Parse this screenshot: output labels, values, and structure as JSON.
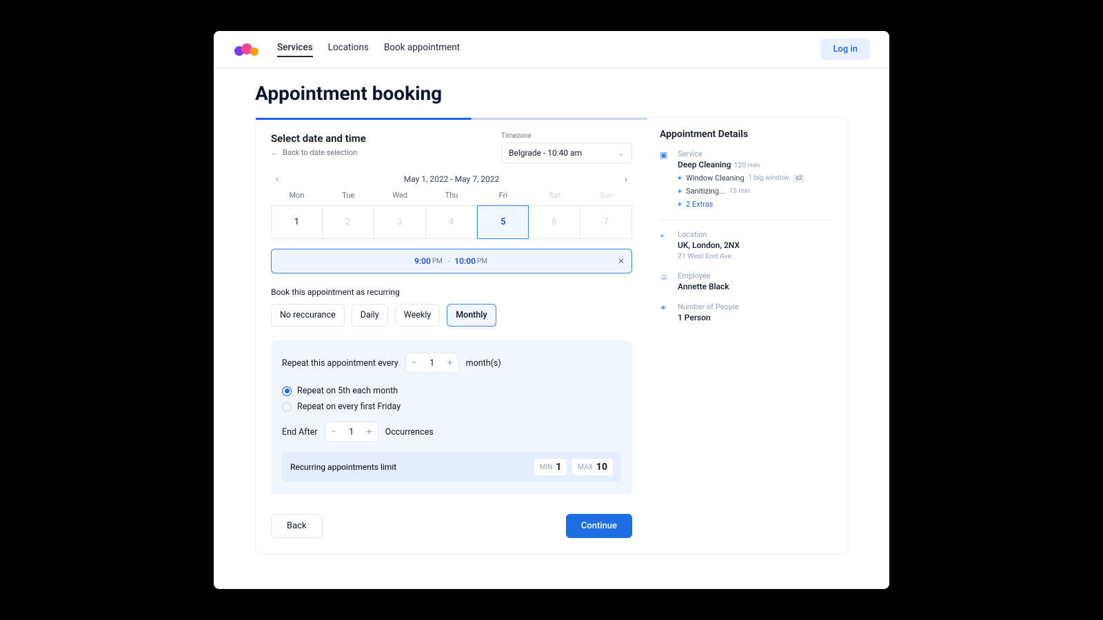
{
  "nav": {
    "services": "Services",
    "locations": "Locations",
    "book": "Book appointment",
    "login": "Log in"
  },
  "page": {
    "title": "Appointment booking"
  },
  "step": {
    "title": "Select date and time",
    "back": "Back to date selection",
    "tzLabel": "Timezone",
    "tzValue": "Belgrade - 10:40 am",
    "range": "May 1, 2022 - May 7, 2022",
    "dayHeads": [
      "Mon",
      "Tue",
      "Wed",
      "Thu",
      "Fri",
      "Sat",
      "Sun"
    ],
    "dayNums": [
      "1",
      "2",
      "3",
      "4",
      "5",
      "6",
      "7"
    ],
    "slot": {
      "t1": "9:00",
      "a1": "PM",
      "dash": "-",
      "t2": "10:00",
      "a2": "PM"
    },
    "recurLabel": "Book this appointment as recurring",
    "recurTabs": [
      "No reccurance",
      "Daily",
      "Weekly",
      "Monthly"
    ],
    "repeat": {
      "label": "Repeat this appointment every",
      "val": "1",
      "unit": "month(s)"
    },
    "radios": {
      "a": "Repeat on 5th each month",
      "b": "Repeat on every first Friday"
    },
    "end": {
      "label": "End After",
      "val": "1",
      "unit": "Occurrences"
    },
    "limit": {
      "label": "Recurring appointments limit",
      "minL": "MIN",
      "minV": "1",
      "maxL": "MAX",
      "maxV": "10"
    }
  },
  "footer": {
    "back": "Back",
    "cont": "Continue"
  },
  "details": {
    "title": "Appointment Details",
    "service": {
      "label": "Service",
      "name": "Deep Cleaning",
      "dur": "120 min",
      "extras": [
        {
          "name": "Window Cleaning",
          "meta": "1 big window",
          "count": "x2"
        },
        {
          "name": "Sanitizing...",
          "meta": "15 min"
        }
      ],
      "moreCount": "2 Extras"
    },
    "location": {
      "label": "Location",
      "name": "UK, London, 2NX",
      "addr": "21 West End Ave"
    },
    "employee": {
      "label": "Employee",
      "name": "Annette Black"
    },
    "people": {
      "label": "Number of People",
      "val": "1 Person"
    }
  }
}
